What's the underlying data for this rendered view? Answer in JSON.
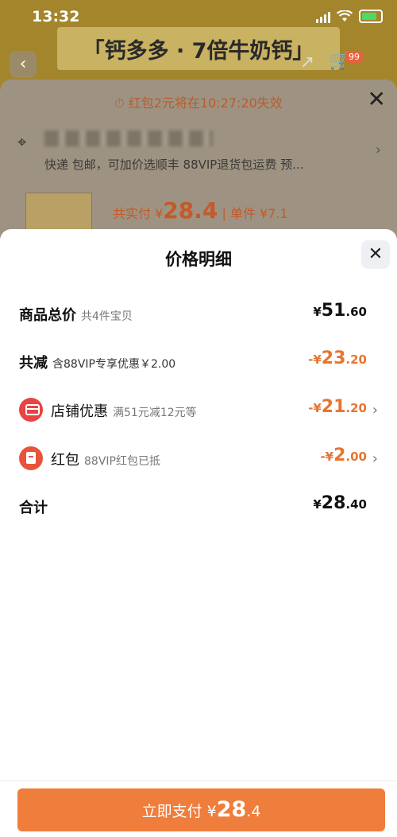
{
  "status": {
    "time": "13:32"
  },
  "background": {
    "title": "「钙多多 · 7倍牛奶钙」",
    "cart_badge": "99",
    "timer_text": "红包2元将在10:27:20失效",
    "shipping": "快递 包邮，可加价选顺丰 88VIP退货包运费 预...",
    "price_label": "共实付 ¥",
    "price_value": "28.4",
    "unit_label": "| 单件 ¥7.1"
  },
  "sheet": {
    "title": "价格明细",
    "rows": [
      {
        "label": "商品总价",
        "sub": "共4件宝贝",
        "currency": "¥",
        "int": "51",
        "dec": ".60"
      },
      {
        "label": "共减",
        "sub": "含88VIP专享优惠￥2.00",
        "currency": "-¥",
        "int": "23",
        "dec": ".20"
      },
      {
        "label": "店铺优惠",
        "sub": "满51元减12元等",
        "currency": "-¥",
        "int": "21",
        "dec": ".20"
      },
      {
        "label": "红包",
        "sub": "88VIP红包已抵",
        "currency": "-¥",
        "int": "2",
        "dec": ".00"
      },
      {
        "label": "合计",
        "sub": "",
        "currency": "¥",
        "int": "28",
        "dec": ".40"
      }
    ]
  },
  "pay_button": {
    "label": "立即支付 ¥",
    "amount": "28",
    "decimal": ".4"
  },
  "colors": {
    "accent": "#ef7d3b",
    "discount": "#e8742f"
  }
}
